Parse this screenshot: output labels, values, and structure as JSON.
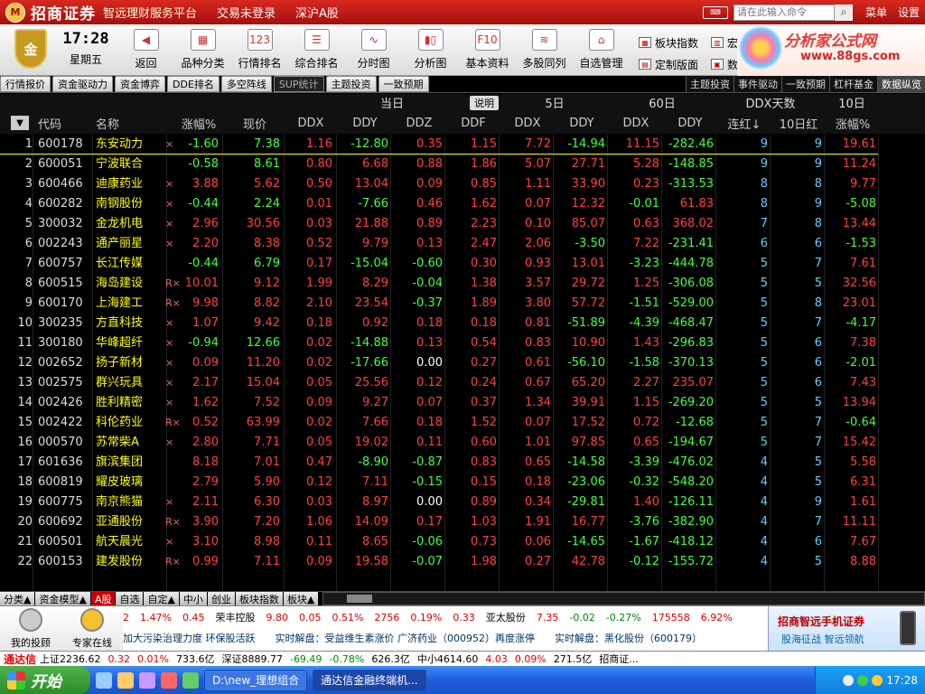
{
  "titlebar": {
    "logo": "M",
    "brand": "招商证券",
    "slogan": "智远理财服务平台",
    "links": [
      "交易未登录",
      "深沪A股"
    ],
    "search_placeholder": "请在此输入命令",
    "buttons": [
      "菜单",
      "设置"
    ]
  },
  "toolbar": {
    "clock_time": "17:28",
    "clock_day": "星期五",
    "badge": "金",
    "tools": [
      {
        "label": "返回",
        "icon": "back-arrow-icon",
        "glyph": "◀"
      },
      {
        "label": "品种分类",
        "icon": "grid-icon",
        "glyph": "▦"
      },
      {
        "label": "行情排名",
        "icon": "ranking-icon",
        "glyph": "123"
      },
      {
        "label": "综合排名",
        "icon": "list-icon",
        "glyph": "☰"
      },
      {
        "label": "分时图",
        "icon": "line-chart-icon",
        "glyph": "∿"
      },
      {
        "label": "分析图",
        "icon": "candlestick-icon",
        "glyph": "▮▯"
      },
      {
        "label": "基本资料",
        "icon": "f10-icon",
        "glyph": "F10"
      },
      {
        "label": "多股同列",
        "icon": "multi-chart-icon",
        "glyph": "≋"
      },
      {
        "label": "自选管理",
        "icon": "portfolio-icon",
        "glyph": "⌂"
      }
    ],
    "right_tools": [
      "板块指数",
      "定制版面",
      "宏观",
      "数据管理"
    ]
  },
  "promo": {
    "title": "分析家公式网",
    "url": "www.88gs.com"
  },
  "category_tabs": [
    "行情报价",
    "资金驱动力",
    "资金博弈",
    "DDE排名",
    "多空阵线",
    "SUP统计",
    "主题投资",
    "一致预期"
  ],
  "right_tabs": [
    "主题投资",
    "事件驱动",
    "一致预期",
    "杠杆基金",
    "数据纵览"
  ],
  "header": {
    "menu_glyph": "▼",
    "code": "代码",
    "name": "名称",
    "chg": "涨幅%",
    "price": "现价",
    "group_today": "当日",
    "explain": "说明",
    "group_5d": "5日",
    "group_60d": "60日",
    "group_ddxdays": "DDX天数",
    "group_10d": "10日",
    "ddx": "DDX",
    "ddy": "DDY",
    "ddz": "DDZ",
    "ddf": "DDF",
    "d5x": "DDX",
    "d5y": "DDY",
    "d60x": "DDX",
    "d60y": "DDY",
    "red": "连红↓",
    "red10": "10日红",
    "chg10": "涨幅%"
  },
  "colors": {
    "up": "#ff4040",
    "down": "#40ff40",
    "flat": "#ffffff",
    "name": "#ffff00",
    "count": "#66ccff"
  },
  "rows": [
    {
      "i": "1",
      "code": "600178",
      "name": "东安动力",
      "mark": "×",
      "chg": "-1.60",
      "price": "7.38",
      "ddx": "1.16",
      "ddy": "-12.80",
      "ddz": "0.35",
      "ddf": "1.15",
      "d5x": "7.72",
      "d5y": "-14.94",
      "d60x": "11.15",
      "d60y": "-282.46",
      "red": "9",
      "red10": "9",
      "chg10": "19.61"
    },
    {
      "i": "2",
      "code": "600051",
      "name": "宁波联合",
      "mark": "",
      "chg": "-0.58",
      "price": "8.61",
      "ddx": "0.80",
      "ddy": "6.68",
      "ddz": "0.88",
      "ddf": "1.86",
      "d5x": "5.07",
      "d5y": "27.71",
      "d60x": "5.28",
      "d60y": "-148.85",
      "red": "9",
      "red10": "9",
      "chg10": "11.24"
    },
    {
      "i": "3",
      "code": "600466",
      "name": "迪康药业",
      "mark": "×",
      "chg": "3.88",
      "price": "5.62",
      "ddx": "0.50",
      "ddy": "13.04",
      "ddz": "0.09",
      "ddf": "0.85",
      "d5x": "1.11",
      "d5y": "33.90",
      "d60x": "0.23",
      "d60y": "-313.53",
      "red": "8",
      "red10": "8",
      "chg10": "9.77"
    },
    {
      "i": "4",
      "code": "600282",
      "name": "南钢股份",
      "mark": "×",
      "chg": "-0.44",
      "price": "2.24",
      "ddx": "0.01",
      "ddy": "-7.66",
      "ddz": "0.46",
      "ddf": "1.62",
      "d5x": "0.07",
      "d5y": "12.32",
      "d60x": "-0.01",
      "d60y": "61.83",
      "red": "8",
      "red10": "9",
      "chg10": "-5.08"
    },
    {
      "i": "5",
      "code": "300032",
      "name": "金龙机电",
      "mark": "×",
      "chg": "2.96",
      "price": "30.56",
      "ddx": "0.03",
      "ddy": "21.88",
      "ddz": "0.89",
      "ddf": "2.23",
      "d5x": "0.10",
      "d5y": "85.07",
      "d60x": "0.63",
      "d60y": "368.02",
      "red": "7",
      "red10": "8",
      "chg10": "13.44"
    },
    {
      "i": "6",
      "code": "002243",
      "name": "通产丽星",
      "mark": "×",
      "chg": "2.20",
      "price": "8.38",
      "ddx": "0.52",
      "ddy": "9.79",
      "ddz": "0.13",
      "ddf": "2.47",
      "d5x": "2.06",
      "d5y": "-3.50",
      "d60x": "7.22",
      "d60y": "-231.41",
      "red": "6",
      "red10": "6",
      "chg10": "-1.53"
    },
    {
      "i": "7",
      "code": "600757",
      "name": "长江传媒",
      "mark": "",
      "chg": "-0.44",
      "price": "6.79",
      "ddx": "0.17",
      "ddy": "-15.04",
      "ddz": "-0.60",
      "ddf": "0.30",
      "d5x": "0.93",
      "d5y": "13.01",
      "d60x": "-3.23",
      "d60y": "-444.78",
      "red": "5",
      "red10": "7",
      "chg10": "7.61"
    },
    {
      "i": "8",
      "code": "600515",
      "name": "海岛建设",
      "mark": "R×",
      "chg": "10.01",
      "price": "9.12",
      "ddx": "1.99",
      "ddy": "8.29",
      "ddz": "-0.04",
      "ddf": "1.38",
      "d5x": "3.57",
      "d5y": "29.72",
      "d60x": "1.25",
      "d60y": "-306.08",
      "red": "5",
      "red10": "5",
      "chg10": "32.56"
    },
    {
      "i": "9",
      "code": "600170",
      "name": "上海建工",
      "mark": "R×",
      "chg": "9.98",
      "price": "8.82",
      "ddx": "2.10",
      "ddy": "23.54",
      "ddz": "-0.37",
      "ddf": "1.89",
      "d5x": "3.80",
      "d5y": "57.72",
      "d60x": "-1.51",
      "d60y": "-529.00",
      "red": "5",
      "red10": "8",
      "chg10": "23.01"
    },
    {
      "i": "10",
      "code": "300235",
      "name": "方直科技",
      "mark": "×",
      "chg": "1.07",
      "price": "9.42",
      "ddx": "0.18",
      "ddy": "0.92",
      "ddz": "0.18",
      "ddf": "0.18",
      "d5x": "0.81",
      "d5y": "-51.89",
      "d60x": "-4.39",
      "d60y": "-468.47",
      "red": "5",
      "red10": "7",
      "chg10": "-4.17"
    },
    {
      "i": "11",
      "code": "300180",
      "name": "华峰超纤",
      "mark": "×",
      "chg": "-0.94",
      "price": "12.66",
      "ddx": "0.02",
      "ddy": "-14.88",
      "ddz": "0.13",
      "ddf": "0.54",
      "d5x": "0.83",
      "d5y": "10.90",
      "d60x": "1.43",
      "d60y": "-296.83",
      "red": "5",
      "red10": "6",
      "chg10": "7.38"
    },
    {
      "i": "12",
      "code": "002652",
      "name": "扬子新材",
      "mark": "×",
      "chg": "0.09",
      "price": "11.20",
      "ddx": "0.02",
      "ddy": "-17.66",
      "ddz": "0.00",
      "ddf": "0.27",
      "d5x": "0.61",
      "d5y": "-56.10",
      "d60x": "-1.58",
      "d60y": "-370.13",
      "red": "5",
      "red10": "6",
      "chg10": "-2.01"
    },
    {
      "i": "13",
      "code": "002575",
      "name": "群兴玩具",
      "mark": "×",
      "chg": "2.17",
      "price": "15.04",
      "ddx": "0.05",
      "ddy": "25.56",
      "ddz": "0.12",
      "ddf": "0.24",
      "d5x": "0.67",
      "d5y": "65.20",
      "d60x": "2.27",
      "d60y": "235.07",
      "red": "5",
      "red10": "6",
      "chg10": "7.43"
    },
    {
      "i": "14",
      "code": "002426",
      "name": "胜利精密",
      "mark": "×",
      "chg": "1.62",
      "price": "7.52",
      "ddx": "0.09",
      "ddy": "9.27",
      "ddz": "0.07",
      "ddf": "0.37",
      "d5x": "1.34",
      "d5y": "39.91",
      "d60x": "1.15",
      "d60y": "-269.20",
      "red": "5",
      "red10": "5",
      "chg10": "13.94"
    },
    {
      "i": "15",
      "code": "002422",
      "name": "科伦药业",
      "mark": "R×",
      "chg": "0.52",
      "price": "63.99",
      "ddx": "0.02",
      "ddy": "7.66",
      "ddz": "0.18",
      "ddf": "1.52",
      "d5x": "0.07",
      "d5y": "17.52",
      "d60x": "0.72",
      "d60y": "-12.68",
      "red": "5",
      "red10": "7",
      "chg10": "-0.64"
    },
    {
      "i": "16",
      "code": "000570",
      "name": "苏常柴A",
      "mark": "×",
      "chg": "2.80",
      "price": "7.71",
      "ddx": "0.05",
      "ddy": "19.02",
      "ddz": "0.11",
      "ddf": "0.60",
      "d5x": "1.01",
      "d5y": "97.85",
      "d60x": "0.65",
      "d60y": "-194.67",
      "red": "5",
      "red10": "7",
      "chg10": "15.42"
    },
    {
      "i": "17",
      "code": "601636",
      "name": "旗滨集团",
      "mark": "",
      "chg": "8.18",
      "price": "7.01",
      "ddx": "0.47",
      "ddy": "-8.90",
      "ddz": "-0.87",
      "ddf": "0.83",
      "d5x": "0.65",
      "d5y": "-14.58",
      "d60x": "-3.39",
      "d60y": "-476.02",
      "red": "4",
      "red10": "5",
      "chg10": "5.58"
    },
    {
      "i": "18",
      "code": "600819",
      "name": "耀皮玻璃",
      "mark": "",
      "chg": "2.79",
      "price": "5.90",
      "ddx": "0.12",
      "ddy": "7.11",
      "ddz": "-0.15",
      "ddf": "0.15",
      "d5x": "0.18",
      "d5y": "-23.06",
      "d60x": "-0.32",
      "d60y": "-548.20",
      "red": "4",
      "red10": "5",
      "chg10": "6.31"
    },
    {
      "i": "19",
      "code": "600775",
      "name": "南京熊猫",
      "mark": "×",
      "chg": "2.11",
      "price": "6.30",
      "ddx": "0.03",
      "ddy": "8.97",
      "ddz": "0.00",
      "ddf": "0.89",
      "d5x": "0.34",
      "d5y": "-29.81",
      "d60x": "1.40",
      "d60y": "-126.11",
      "red": "4",
      "red10": "9",
      "chg10": "1.61"
    },
    {
      "i": "20",
      "code": "600692",
      "name": "亚通股份",
      "mark": "R×",
      "chg": "3.90",
      "price": "7.20",
      "ddx": "1.06",
      "ddy": "14.09",
      "ddz": "0.17",
      "ddf": "1.03",
      "d5x": "1.91",
      "d5y": "16.77",
      "d60x": "-3.76",
      "d60y": "-382.90",
      "red": "4",
      "red10": "7",
      "chg10": "11.11"
    },
    {
      "i": "21",
      "code": "600501",
      "name": "航天晨光",
      "mark": "×",
      "chg": "3.10",
      "price": "8.98",
      "ddx": "0.11",
      "ddy": "8.65",
      "ddz": "-0.06",
      "ddf": "0.73",
      "d5x": "0.06",
      "d5y": "-14.65",
      "d60x": "-1.67",
      "d60y": "-418.12",
      "red": "4",
      "red10": "6",
      "chg10": "7.67"
    },
    {
      "i": "22",
      "code": "600153",
      "name": "建发股份",
      "mark": "R×",
      "chg": "0.99",
      "price": "7.11",
      "ddx": "0.09",
      "ddy": "19.58",
      "ddz": "-0.07",
      "ddf": "1.98",
      "d5x": "0.27",
      "d5y": "42.78",
      "d60x": "-0.12",
      "d60y": "-155.72",
      "red": "4",
      "red10": "5",
      "chg10": "8.88"
    }
  ],
  "bottom_tabs": [
    "分类▲",
    "资金模型▲",
    "A股",
    "自选",
    "自定▲",
    "中小",
    "创业",
    "板块指数",
    "板块▲"
  ],
  "news": {
    "avatars": [
      "我的投顾",
      "专家在线"
    ],
    "ticker": [
      "2",
      "1.47%",
      "0.45",
      "荣丰控股",
      "9.80",
      "0.05",
      "0.51%",
      "2756",
      "0.19%",
      "0.33",
      "亚太股份",
      "7.35",
      "-0.02",
      "-0.27%",
      "175558",
      "6.92%"
    ],
    "headlines": [
      "加大污染治理力度 环保股活跃",
      "实时解盘：受益维生素涨价 广济药业（000952）再度涨停",
      "实时解盘：黑化股份（600179）"
    ],
    "ad_title": "招商智远手机证券",
    "ad_sub": "股海征战 智远领航"
  },
  "statusbar": {
    "logo": "通达信",
    "items": [
      "上证2236.62",
      "0.32",
      "0.01%",
      "733.6亿",
      "深证8889.77",
      "-69.49",
      "-0.78%",
      "626.3亿",
      "中小4614.60",
      "4.03",
      "0.09%",
      "271.5亿",
      "招商证..."
    ]
  },
  "taskbar": {
    "start": "开始",
    "tasks": [
      "D:\\new_理想组合",
      "通达信金融终端机..."
    ],
    "time": "17:28"
  }
}
